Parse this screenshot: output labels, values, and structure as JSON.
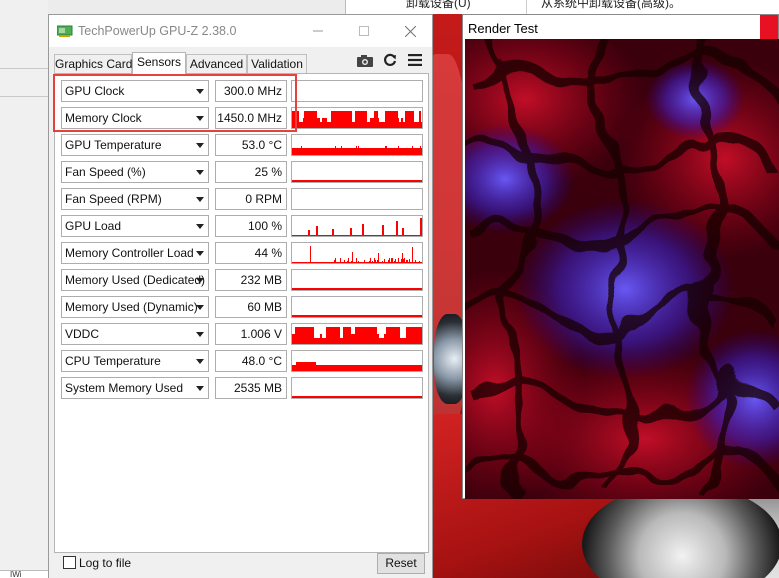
{
  "gpuz": {
    "title": "TechPowerUp GPU-Z 2.38.0",
    "tabs": [
      {
        "label": "Graphics Card"
      },
      {
        "label": "Sensors"
      },
      {
        "label": "Advanced"
      },
      {
        "label": "Validation"
      }
    ],
    "active_tab": "Sensors",
    "sensors": [
      {
        "name": "GPU Clock",
        "value": "300.0 MHz",
        "graph": "empty"
      },
      {
        "name": "Memory Clock",
        "value": "1450.0 MHz",
        "graph": "bars_high"
      },
      {
        "name": "GPU Temperature",
        "value": "53.0 °C",
        "graph": "flat_high"
      },
      {
        "name": "Fan Speed (%)",
        "value": "25 %",
        "graph": "flat_low"
      },
      {
        "name": "Fan Speed (RPM)",
        "value": "0 RPM",
        "graph": "empty"
      },
      {
        "name": "GPU Load",
        "value": "100 %",
        "graph": "spikes"
      },
      {
        "name": "Memory Controller Load",
        "value": "44 %",
        "graph": "mc_load"
      },
      {
        "name": "Memory Used (Dedicated)",
        "value": "232 MB",
        "graph": "flat_low"
      },
      {
        "name": "Memory Used (Dynamic)",
        "value": "60 MB",
        "graph": "flat_low"
      },
      {
        "name": "VDDC",
        "value": "1.006 V",
        "graph": "bars_high"
      },
      {
        "name": "CPU Temperature",
        "value": "48.0 °C",
        "graph": "flat_mid"
      },
      {
        "name": "System Memory Used",
        "value": "2535 MB",
        "graph": "flat_low"
      }
    ],
    "log_to_file_label": "Log to file",
    "log_to_file_checked": false,
    "reset_label": "Reset",
    "graph_color": "#ff0000"
  },
  "render_window": {
    "title": "Render Test",
    "close_color": "#e81123"
  },
  "background": {
    "top_text_1": "卸载设备(U)",
    "top_text_2": "从系统中卸载设备(高级)。",
    "left_bottom_text": "IWi"
  }
}
